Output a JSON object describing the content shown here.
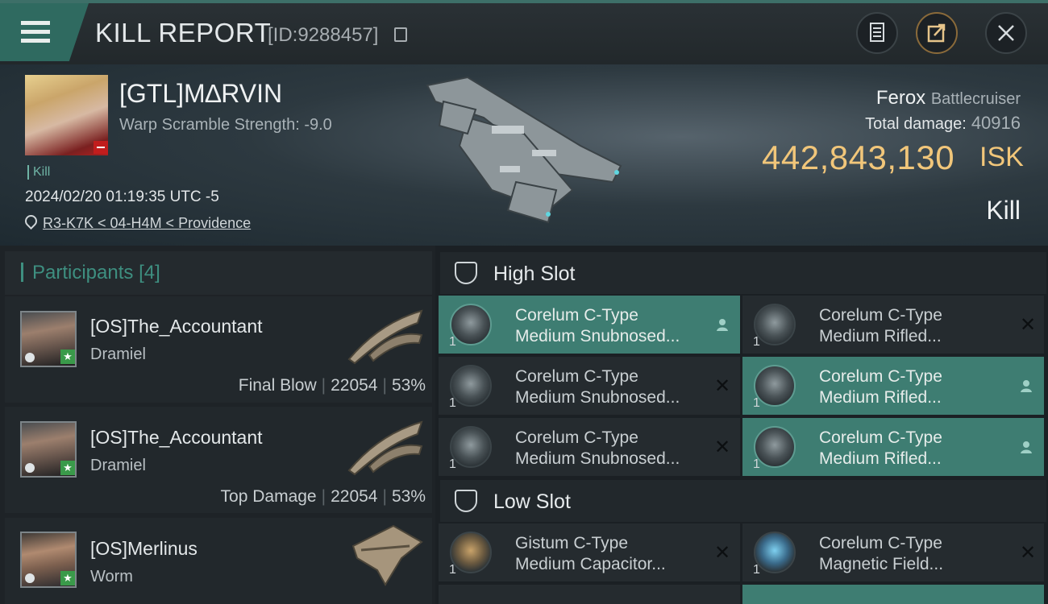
{
  "header": {
    "title": "KILL REPORT",
    "report_id": "[ID:9288457]"
  },
  "victim": {
    "name": "[GTL]M∆RVIN",
    "warp_scramble": "Warp Scramble Strength: -9.0",
    "tag": "Kill",
    "datetime": "2024/02/20 01:19:35 UTC -5",
    "location": "R3-K7K < 04-H4M < Providence",
    "ship": "Ferox",
    "ship_class": "Battlecruiser",
    "total_damage_label": "Total damage:",
    "total_damage": "40916",
    "isk_value": "442,843,130",
    "isk_unit": "ISK",
    "result": "Kill"
  },
  "participants": {
    "title": "Participants",
    "count": "[4]",
    "rows": [
      {
        "name": "[OS]The_Accountant",
        "ship": "Dramiel",
        "stat_label": "Final Blow",
        "damage": "22054",
        "percent": "53%"
      },
      {
        "name": "[OS]The_Accountant",
        "ship": "Dramiel",
        "stat_label": "Top Damage",
        "damage": "22054",
        "percent": "53%"
      },
      {
        "name": "[OS]Merlinus",
        "ship": "Worm"
      }
    ]
  },
  "high_slot": {
    "title": "High Slot",
    "modules": [
      {
        "qty": "1",
        "line1": "Corelum C-Type",
        "line2": "Medium Snubnosed...",
        "highlighted": true
      },
      {
        "qty": "1",
        "line1": "Corelum C-Type",
        "line2": "Medium Rifled...",
        "highlighted": false
      },
      {
        "qty": "1",
        "line1": "Corelum C-Type",
        "line2": "Medium Snubnosed...",
        "highlighted": false
      },
      {
        "qty": "1",
        "line1": "Corelum C-Type",
        "line2": "Medium Rifled...",
        "highlighted": true
      },
      {
        "qty": "1",
        "line1": "Corelum C-Type",
        "line2": "Medium Snubnosed...",
        "highlighted": false
      },
      {
        "qty": "1",
        "line1": "Corelum C-Type",
        "line2": "Medium Rifled...",
        "highlighted": true
      }
    ]
  },
  "low_slot": {
    "title": "Low Slot",
    "modules": [
      {
        "qty": "1",
        "line1": "Gistum C-Type",
        "line2": "Medium Capacitor...",
        "highlighted": false
      },
      {
        "qty": "1",
        "line1": "Corelum C-Type",
        "line2": "Magnetic Field...",
        "highlighted": false
      }
    ]
  },
  "icons": {
    "menu": "hamburger-icon",
    "copy": "copy-icon",
    "document": "document-icon",
    "share": "share-icon",
    "close": "close-icon",
    "location": "map-pin-icon",
    "remove": "x-icon",
    "person": "person-icon"
  },
  "colors": {
    "accent": "#3e8f80",
    "isk": "#f1c67a",
    "highlight_row": "#3e7d72"
  }
}
